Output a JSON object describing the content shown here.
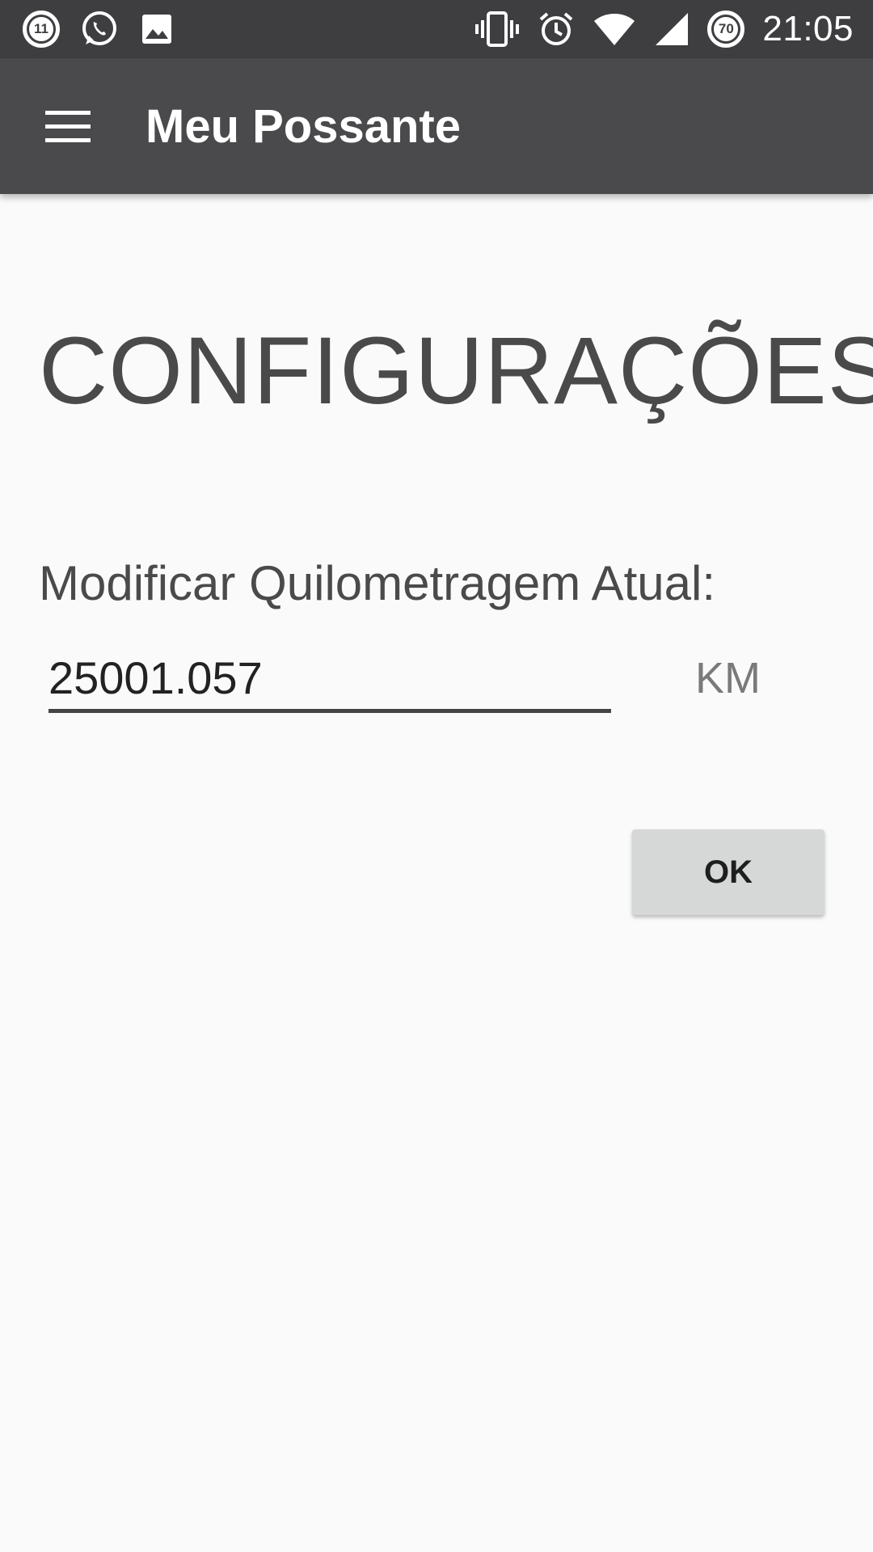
{
  "status_bar": {
    "time": "21:05",
    "notification_badge": "11",
    "battery_level": "70",
    "left_icons": [
      "notification-count-icon",
      "whatsapp-icon",
      "image-icon"
    ],
    "right_icons": [
      "vibrate-icon",
      "alarm-icon",
      "wifi-icon",
      "cell-signal-icon",
      "battery-icon"
    ]
  },
  "app_bar": {
    "title": "Meu Possante",
    "menu_icon": "hamburger-menu-icon"
  },
  "page": {
    "heading": "CONFIGURAÇÕES",
    "field_label": "Modificar Quilometragem Atual:",
    "km_value": "25001.057",
    "unit": "KM",
    "ok_label": "OK"
  },
  "colors": {
    "status_bar": "#3e3e40",
    "app_bar": "#4a4a4c",
    "background": "#fafafa",
    "button": "#d6d7d7"
  }
}
